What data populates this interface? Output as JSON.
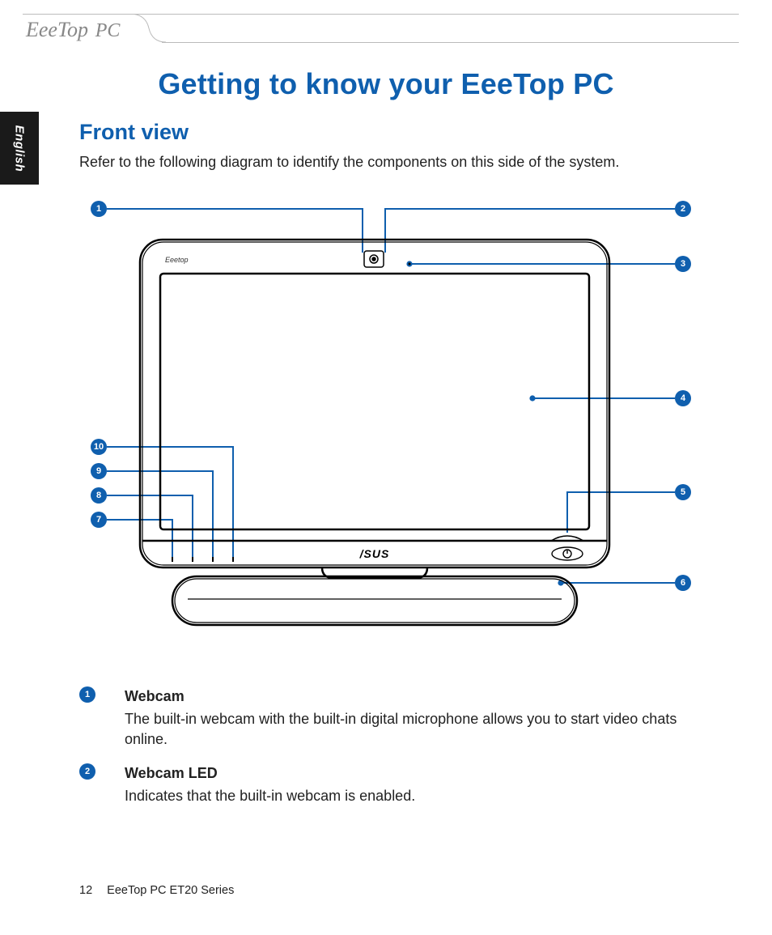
{
  "header_logo_text": "EeeTop",
  "header_logo_suffix": "PC",
  "side_tab": "English",
  "title": "Getting to know your EeeTop PC",
  "subtitle": "Front view",
  "intro": "Refer to the following diagram to identify the components on this side of the system.",
  "device_small_logo": "Eeetop",
  "device_brand": "/SUS",
  "callouts": {
    "c1": "1",
    "c2": "2",
    "c3": "3",
    "c4": "4",
    "c5": "5",
    "c6": "6",
    "c7": "7",
    "c8": "8",
    "c9": "9",
    "c10": "10"
  },
  "descriptions": [
    {
      "num": "1",
      "title": "Webcam",
      "body": "The built-in webcam with the built-in digital microphone allows you to start video chats online."
    },
    {
      "num": "2",
      "title": "Webcam LED",
      "body": "Indicates that the built-in webcam is enabled."
    }
  ],
  "footer_page": "12",
  "footer_text": "EeeTop PC ET20 Series"
}
